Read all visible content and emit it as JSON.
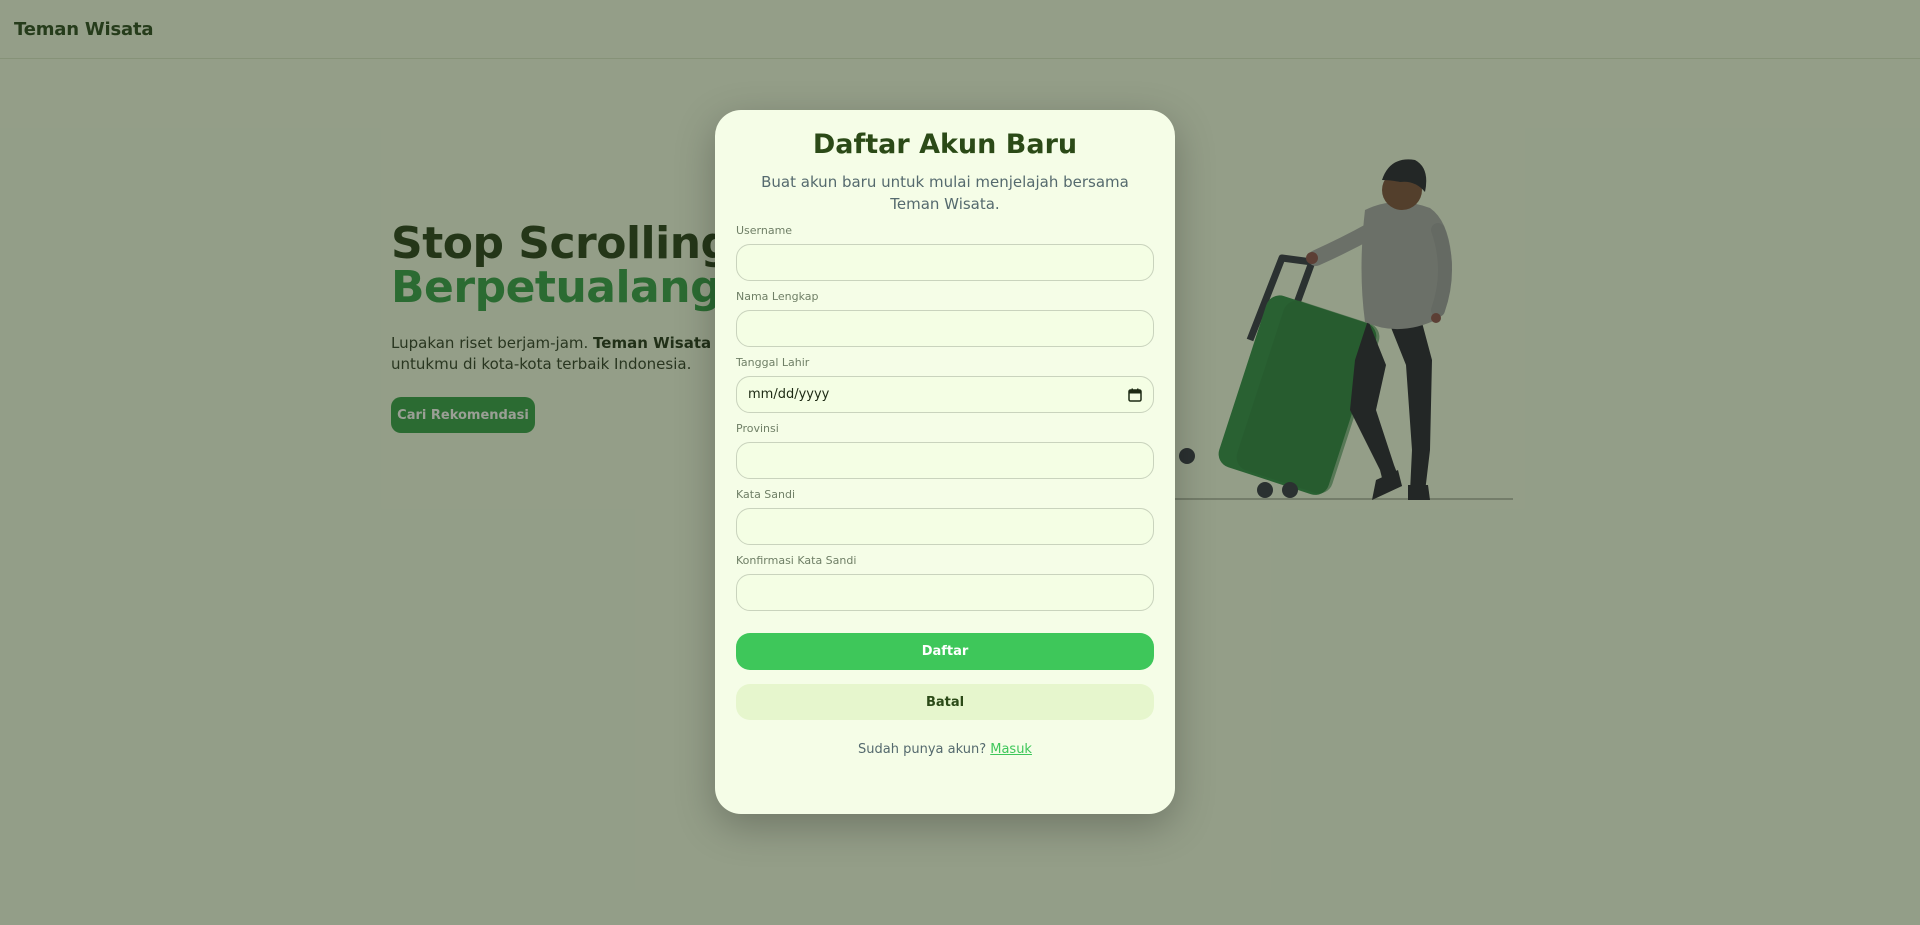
{
  "navbar": {
    "brand": "Teman Wisata"
  },
  "hero": {
    "title_line1": "Stop Scrolling, Mulai",
    "title_line2": "Berpetualang",
    "desc_start": "Lupakan riset berjam-jam. ",
    "desc_bold": "Teman Wisata",
    "desc_end": " menemukan destinasi terbaik untukmu di kota-kota terbaik Indonesia.",
    "cta_label": "Cari Rekomendasi"
  },
  "illustration": {
    "icon": "traveler-with-suitcase-illustration"
  },
  "modal": {
    "title": "Daftar Akun Baru",
    "subtitle": "Buat akun baru untuk mulai menjelajah bersama Teman Wisata.",
    "fields": {
      "username": {
        "label": "Username",
        "value": ""
      },
      "fullname": {
        "label": "Nama Lengkap",
        "value": ""
      },
      "birthdate": {
        "label": "Tanggal Lahir",
        "placeholder": "mm/dd/yyyy"
      },
      "province": {
        "label": "Provinsi",
        "value": ""
      },
      "password": {
        "label": "Kata Sandi",
        "value": ""
      },
      "confirm_password": {
        "label": "Konfirmasi Kata Sandi",
        "value": ""
      }
    },
    "submit_label": "Daftar",
    "cancel_label": "Batal",
    "footer_text": "Sudah punya akun?",
    "login_link": "Masuk"
  },
  "colors": {
    "primary_green": "#3ec75a",
    "dark_green": "#2b4a17",
    "hero_accent": "#2f9e44",
    "suitcase": "#2a8a45",
    "overlay": "rgba(40,52,30,0.47)"
  }
}
